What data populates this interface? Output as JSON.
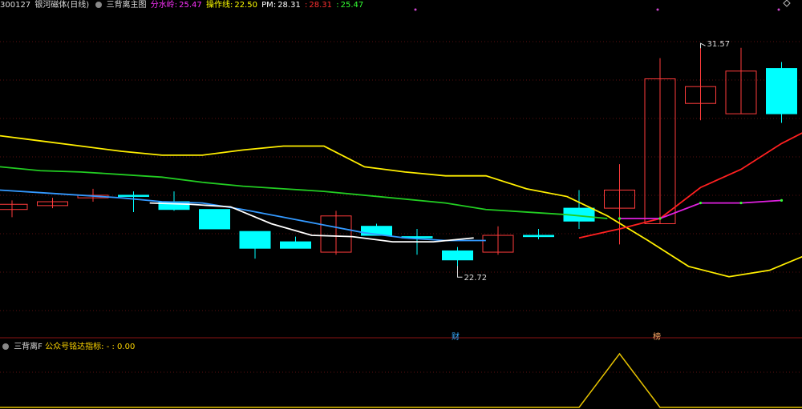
{
  "header": {
    "code": "300127",
    "name": "银河磁体(日线)",
    "indicator": "三背离主图",
    "series": [
      {
        "label": "分水岭:",
        "value": "25.47",
        "color": "#ff33ff"
      },
      {
        "label": "操作线:",
        "value": "22.50",
        "color": "#ffff00"
      },
      {
        "label": "PM:",
        "value": "28.31",
        "color": "#ffffff"
      },
      {
        "label": ":",
        "value": "28.31",
        "color": "#ff3030"
      },
      {
        "label": ":",
        "value": "25.47",
        "color": "#33ff33"
      }
    ]
  },
  "sub": {
    "name": "三背离F",
    "label": "公众号铭达指标:",
    "value": "- : 0.00"
  },
  "markers": {
    "cai": "财",
    "bang": "榜"
  },
  "annotations": {
    "high": "31.57",
    "low": "22.72"
  },
  "colors": {
    "up": "#ff3b3b",
    "down": "#00ffff",
    "yellow_line": "#ffee00",
    "green_line": "#22cc22",
    "blue_line": "#3399ff",
    "sub_line": "#e6c200"
  },
  "chart_data": {
    "type": "candlestick",
    "ylim": [
      20.5,
      33.0
    ],
    "candles": [
      {
        "o": 25.35,
        "h": 25.5,
        "l": 24.85,
        "c": 25.15,
        "dir": "up"
      },
      {
        "o": 25.3,
        "h": 25.6,
        "l": 25.2,
        "c": 25.45,
        "dir": "up"
      },
      {
        "o": 25.6,
        "h": 25.95,
        "l": 25.45,
        "c": 25.7,
        "dir": "up"
      },
      {
        "o": 25.7,
        "h": 25.85,
        "l": 25.05,
        "c": 25.7,
        "dir": "down"
      },
      {
        "o": 25.45,
        "h": 25.85,
        "l": 25.1,
        "c": 25.15,
        "dir": "down"
      },
      {
        "o": 25.15,
        "h": 25.15,
        "l": 24.4,
        "c": 24.4,
        "dir": "down"
      },
      {
        "o": 24.3,
        "h": 24.3,
        "l": 23.25,
        "c": 23.65,
        "dir": "down"
      },
      {
        "o": 23.9,
        "h": 24.1,
        "l": 23.65,
        "c": 23.65,
        "dir": "down"
      },
      {
        "o": 23.5,
        "h": 25.1,
        "l": 23.4,
        "c": 24.9,
        "dir": "up"
      },
      {
        "o": 24.5,
        "h": 24.6,
        "l": 24.15,
        "c": 24.15,
        "dir": "down"
      },
      {
        "o": 24.1,
        "h": 24.4,
        "l": 23.4,
        "c": 24.05,
        "dir": "down"
      },
      {
        "o": 23.55,
        "h": 23.7,
        "l": 22.72,
        "c": 23.2,
        "dir": "down"
      },
      {
        "o": 23.5,
        "h": 24.5,
        "l": 23.4,
        "c": 24.15,
        "dir": "up"
      },
      {
        "o": 24.15,
        "h": 24.4,
        "l": 24.0,
        "c": 24.1,
        "dir": "down"
      },
      {
        "o": 25.2,
        "h": 25.9,
        "l": 24.4,
        "c": 24.7,
        "dir": "down"
      },
      {
        "o": 25.2,
        "h": 26.9,
        "l": 23.8,
        "c": 25.9,
        "dir": "up"
      },
      {
        "o": 24.6,
        "h": 31.0,
        "l": 24.6,
        "c": 30.2,
        "dir": "up"
      },
      {
        "o": 29.25,
        "h": 31.57,
        "l": 28.6,
        "c": 29.9,
        "dir": "up"
      },
      {
        "o": 28.85,
        "h": 31.4,
        "l": 28.85,
        "c": 30.5,
        "dir": "up"
      },
      {
        "o": 30.6,
        "h": 30.85,
        "l": 28.5,
        "c": 28.85,
        "dir": "down"
      }
    ],
    "yellow_line": [
      28.0,
      27.8,
      27.6,
      27.4,
      27.25,
      27.25,
      27.45,
      27.6,
      27.6,
      26.8,
      26.6,
      26.45,
      26.45,
      25.95,
      25.65,
      24.9,
      23.95,
      22.95,
      22.55,
      22.8,
      23.45
    ],
    "green_line": [
      26.8,
      26.65,
      26.6,
      26.5,
      26.4,
      26.2,
      26.05,
      25.95,
      25.85,
      25.7,
      25.55,
      25.4,
      25.15,
      25.05,
      24.95,
      24.8
    ],
    "blue_line": [
      25.9,
      25.8,
      25.7,
      25.6,
      25.45,
      25.4,
      25.15,
      24.85,
      24.55,
      24.25,
      24.05,
      23.95,
      23.95
    ],
    "white_line": [
      25.4,
      25.35,
      25.25,
      24.6,
      24.15,
      24.1,
      23.9,
      23.9,
      24.05
    ],
    "red_line": [
      24.05,
      24.4,
      24.8,
      26.0,
      26.7,
      27.7,
      28.5,
      29.0
    ],
    "magenta_line": [
      24.8,
      24.8,
      25.4,
      25.4,
      25.5
    ],
    "sub_series": [
      0,
      0,
      0,
      0,
      0,
      0,
      0,
      0,
      0,
      0,
      0,
      0,
      0,
      0,
      0,
      1,
      0,
      0,
      0,
      0
    ]
  }
}
